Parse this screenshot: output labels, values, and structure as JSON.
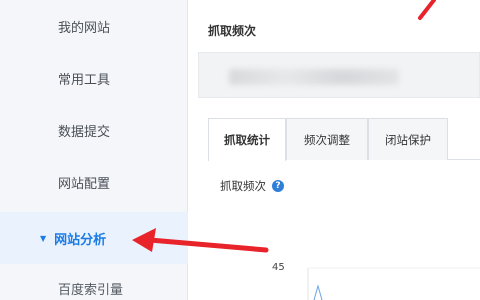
{
  "sidebar": {
    "items": [
      {
        "label": "我的网站"
      },
      {
        "label": "常用工具"
      },
      {
        "label": "数据提交"
      },
      {
        "label": "网站配置"
      },
      {
        "label": "网站分析",
        "active": true
      },
      {
        "label": "百度索引量"
      }
    ]
  },
  "main": {
    "section_title": "抓取频次",
    "tabs": [
      {
        "label": "抓取统计",
        "active": true
      },
      {
        "label": "频次调整"
      },
      {
        "label": "闭站保护"
      }
    ],
    "chart_title": "抓取频次",
    "help_icon": "?"
  },
  "chart_data": {
    "type": "line",
    "ytick_visible": "45"
  },
  "colors": {
    "accent": "#1a7ce6",
    "annotation": "#e8232a",
    "sidebar_bg": "#f4f6f9"
  },
  "icons": {
    "caret": "caret-down-icon",
    "help": "help-icon",
    "annotation_arrow": "red-arrow-annotation"
  }
}
